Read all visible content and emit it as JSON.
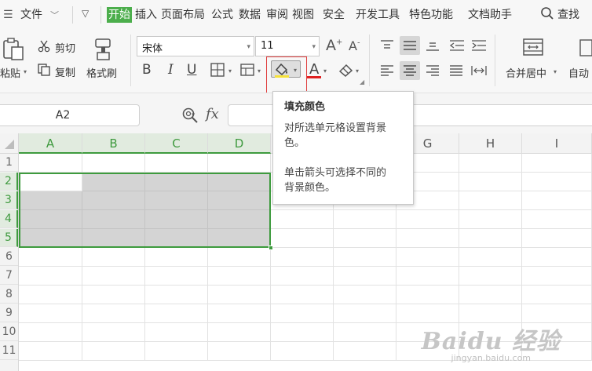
{
  "menubar": {
    "file_label": "文件",
    "tabs": [
      "开始",
      "插入",
      "页面布局",
      "公式",
      "数据",
      "审阅",
      "视图",
      "安全",
      "开发工具",
      "特色功能",
      "文档助手"
    ],
    "search_label": "查找"
  },
  "ribbon": {
    "paste_label": "粘贴",
    "cut_label": "剪切",
    "copy_label": "复制",
    "format_painter_label": "格式刷",
    "font_name": "宋体",
    "font_size": "11",
    "bold_glyph": "B",
    "italic_glyph": "I",
    "underline_glyph": "U",
    "merge_center_label": "合并居中",
    "auto_wrap_label": "自动",
    "font_color_glyph": "A",
    "grow_font_glyph": "A",
    "shrink_font_glyph": "A"
  },
  "formula": {
    "name_box_value": "A2",
    "fx_label": "fx"
  },
  "sheet": {
    "columns": [
      "A",
      "B",
      "C",
      "D",
      "E",
      "F",
      "G",
      "H",
      "I"
    ],
    "rows": [
      "1",
      "2",
      "3",
      "4",
      "5",
      "6",
      "7",
      "8",
      "9",
      "10",
      "11"
    ]
  },
  "tooltip": {
    "title": "填充颜色",
    "line1": "对所选单元格设置背景",
    "line2": "色。",
    "line3": "单击箭头可选择不同的",
    "line4": "背景颜色。"
  },
  "watermark": {
    "main": "Baidu 经验",
    "sub": "jingyan.baidu.com"
  },
  "colors": {
    "accent_green": "#4cae4c",
    "selection_border": "#3e9b3e",
    "fill_gray": "#d4d4d4",
    "font_color_red": "#e02020",
    "fill_yellow": "#f5e13a",
    "highlight_box": "#e04040"
  }
}
